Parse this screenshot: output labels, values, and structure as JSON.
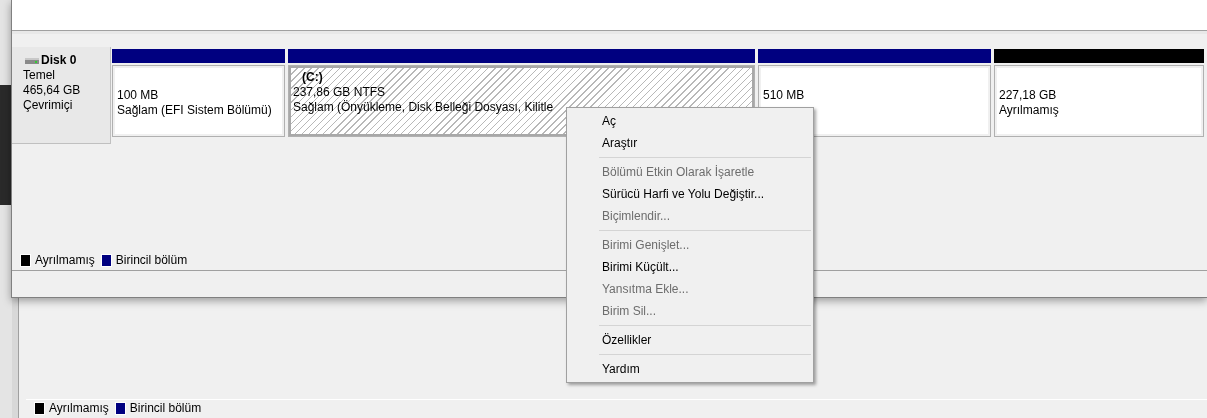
{
  "disk": {
    "name": "Disk 0",
    "type": "Temel",
    "size": "465,64 GB",
    "status": "Çevrimiçi"
  },
  "partitions": [
    {
      "color": "#000080",
      "hatched": false,
      "lines": [
        "100 MB",
        "Sağlam (EFI Sistem Bölümü)"
      ]
    },
    {
      "color": "#000080",
      "hatched": true,
      "title": "(C:)",
      "lines": [
        "237,86 GB NTFS",
        "Sağlam (Önyükleme, Disk Belleği Dosyası, Kilitle"
      ]
    },
    {
      "color": "#000080",
      "hatched": false,
      "lines": [
        "510 MB"
      ]
    },
    {
      "color": "#000000",
      "hatched": false,
      "lines": [
        "227,18 GB",
        "Ayrılmamış"
      ]
    }
  ],
  "legend": [
    {
      "label": "Ayrılmamış",
      "color": "#000000"
    },
    {
      "label": "Birincil bölüm",
      "color": "#000080"
    }
  ],
  "back_legend": [
    {
      "label": "Ayrılmamış",
      "color": "#000000"
    },
    {
      "label": "Birincil bölüm",
      "color": "#000080"
    }
  ],
  "context_menu": [
    {
      "kind": "item",
      "label": "Aç",
      "disabled": false
    },
    {
      "kind": "item",
      "label": "Araştır",
      "disabled": false
    },
    {
      "kind": "separator"
    },
    {
      "kind": "item",
      "label": "Bölümü Etkin Olarak İşaretle",
      "disabled": true
    },
    {
      "kind": "item",
      "label": "Sürücü Harfi ve Yolu Değiştir...",
      "disabled": false
    },
    {
      "kind": "item",
      "label": "Biçimlendir...",
      "disabled": true
    },
    {
      "kind": "separator"
    },
    {
      "kind": "item",
      "label": "Birimi Genişlet...",
      "disabled": true
    },
    {
      "kind": "item",
      "label": "Birimi Küçült...",
      "disabled": false
    },
    {
      "kind": "item",
      "label": "Yansıtma Ekle...",
      "disabled": true
    },
    {
      "kind": "item",
      "label": "Birim Sil...",
      "disabled": true
    },
    {
      "kind": "separator"
    },
    {
      "kind": "item",
      "label": "Özellikler",
      "disabled": false
    },
    {
      "kind": "separator"
    },
    {
      "kind": "item",
      "label": "Yardım",
      "disabled": false
    }
  ]
}
